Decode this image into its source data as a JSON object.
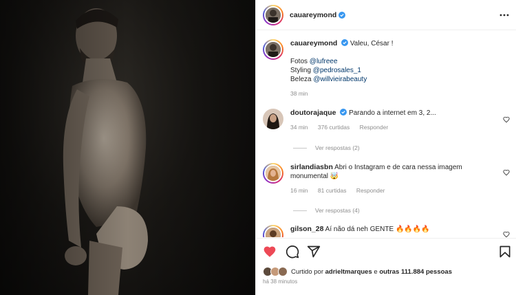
{
  "post": {
    "author": "cauareymond",
    "photo_alt": "",
    "caption": {
      "text": "Valeu, César !",
      "credits": [
        {
          "label": "Fotos",
          "handle": "@lufreee"
        },
        {
          "label": "Styling",
          "handle": "@pedrosales_1"
        },
        {
          "label": "Beleza",
          "handle": "@willvieirabeauty"
        }
      ],
      "time": "38 min"
    }
  },
  "comments": [
    {
      "username": "doutorajaque",
      "verified": true,
      "text": "Parando a internet em 3, 2...",
      "time": "34 min",
      "likes": "376 curtidas",
      "reply_label": "Responder",
      "view_replies": "Ver respostas (2)"
    },
    {
      "username": "sirlandiasbn",
      "verified": false,
      "text": "Abri o Instagram e de cara nessa imagem monumental 🤯",
      "time": "16 min",
      "likes": "81 curtidas",
      "reply_label": "Responder",
      "view_replies": "Ver respostas (4)"
    },
    {
      "username": "gilson_28",
      "verified": false,
      "text": "Aí não dá neh GENTE 🔥🔥🔥🔥",
      "time": "",
      "likes": "",
      "reply_label": "",
      "view_replies": ""
    }
  ],
  "actions": {
    "liked": true,
    "like_icon": "heart-filled-icon",
    "comment_icon": "comment-icon",
    "share_icon": "share-icon",
    "save_icon": "bookmark-icon",
    "like_color": "#ed4956"
  },
  "likes_summary": {
    "prefix": "Curtido por",
    "user": "adrieltmarques",
    "middle": "e",
    "others": "outras 111.884 pessoas"
  },
  "posted_ago": "há 38 minutos",
  "colors": {
    "verified": "#3897f0",
    "mention": "#00376b",
    "muted": "#8e8e8e"
  }
}
